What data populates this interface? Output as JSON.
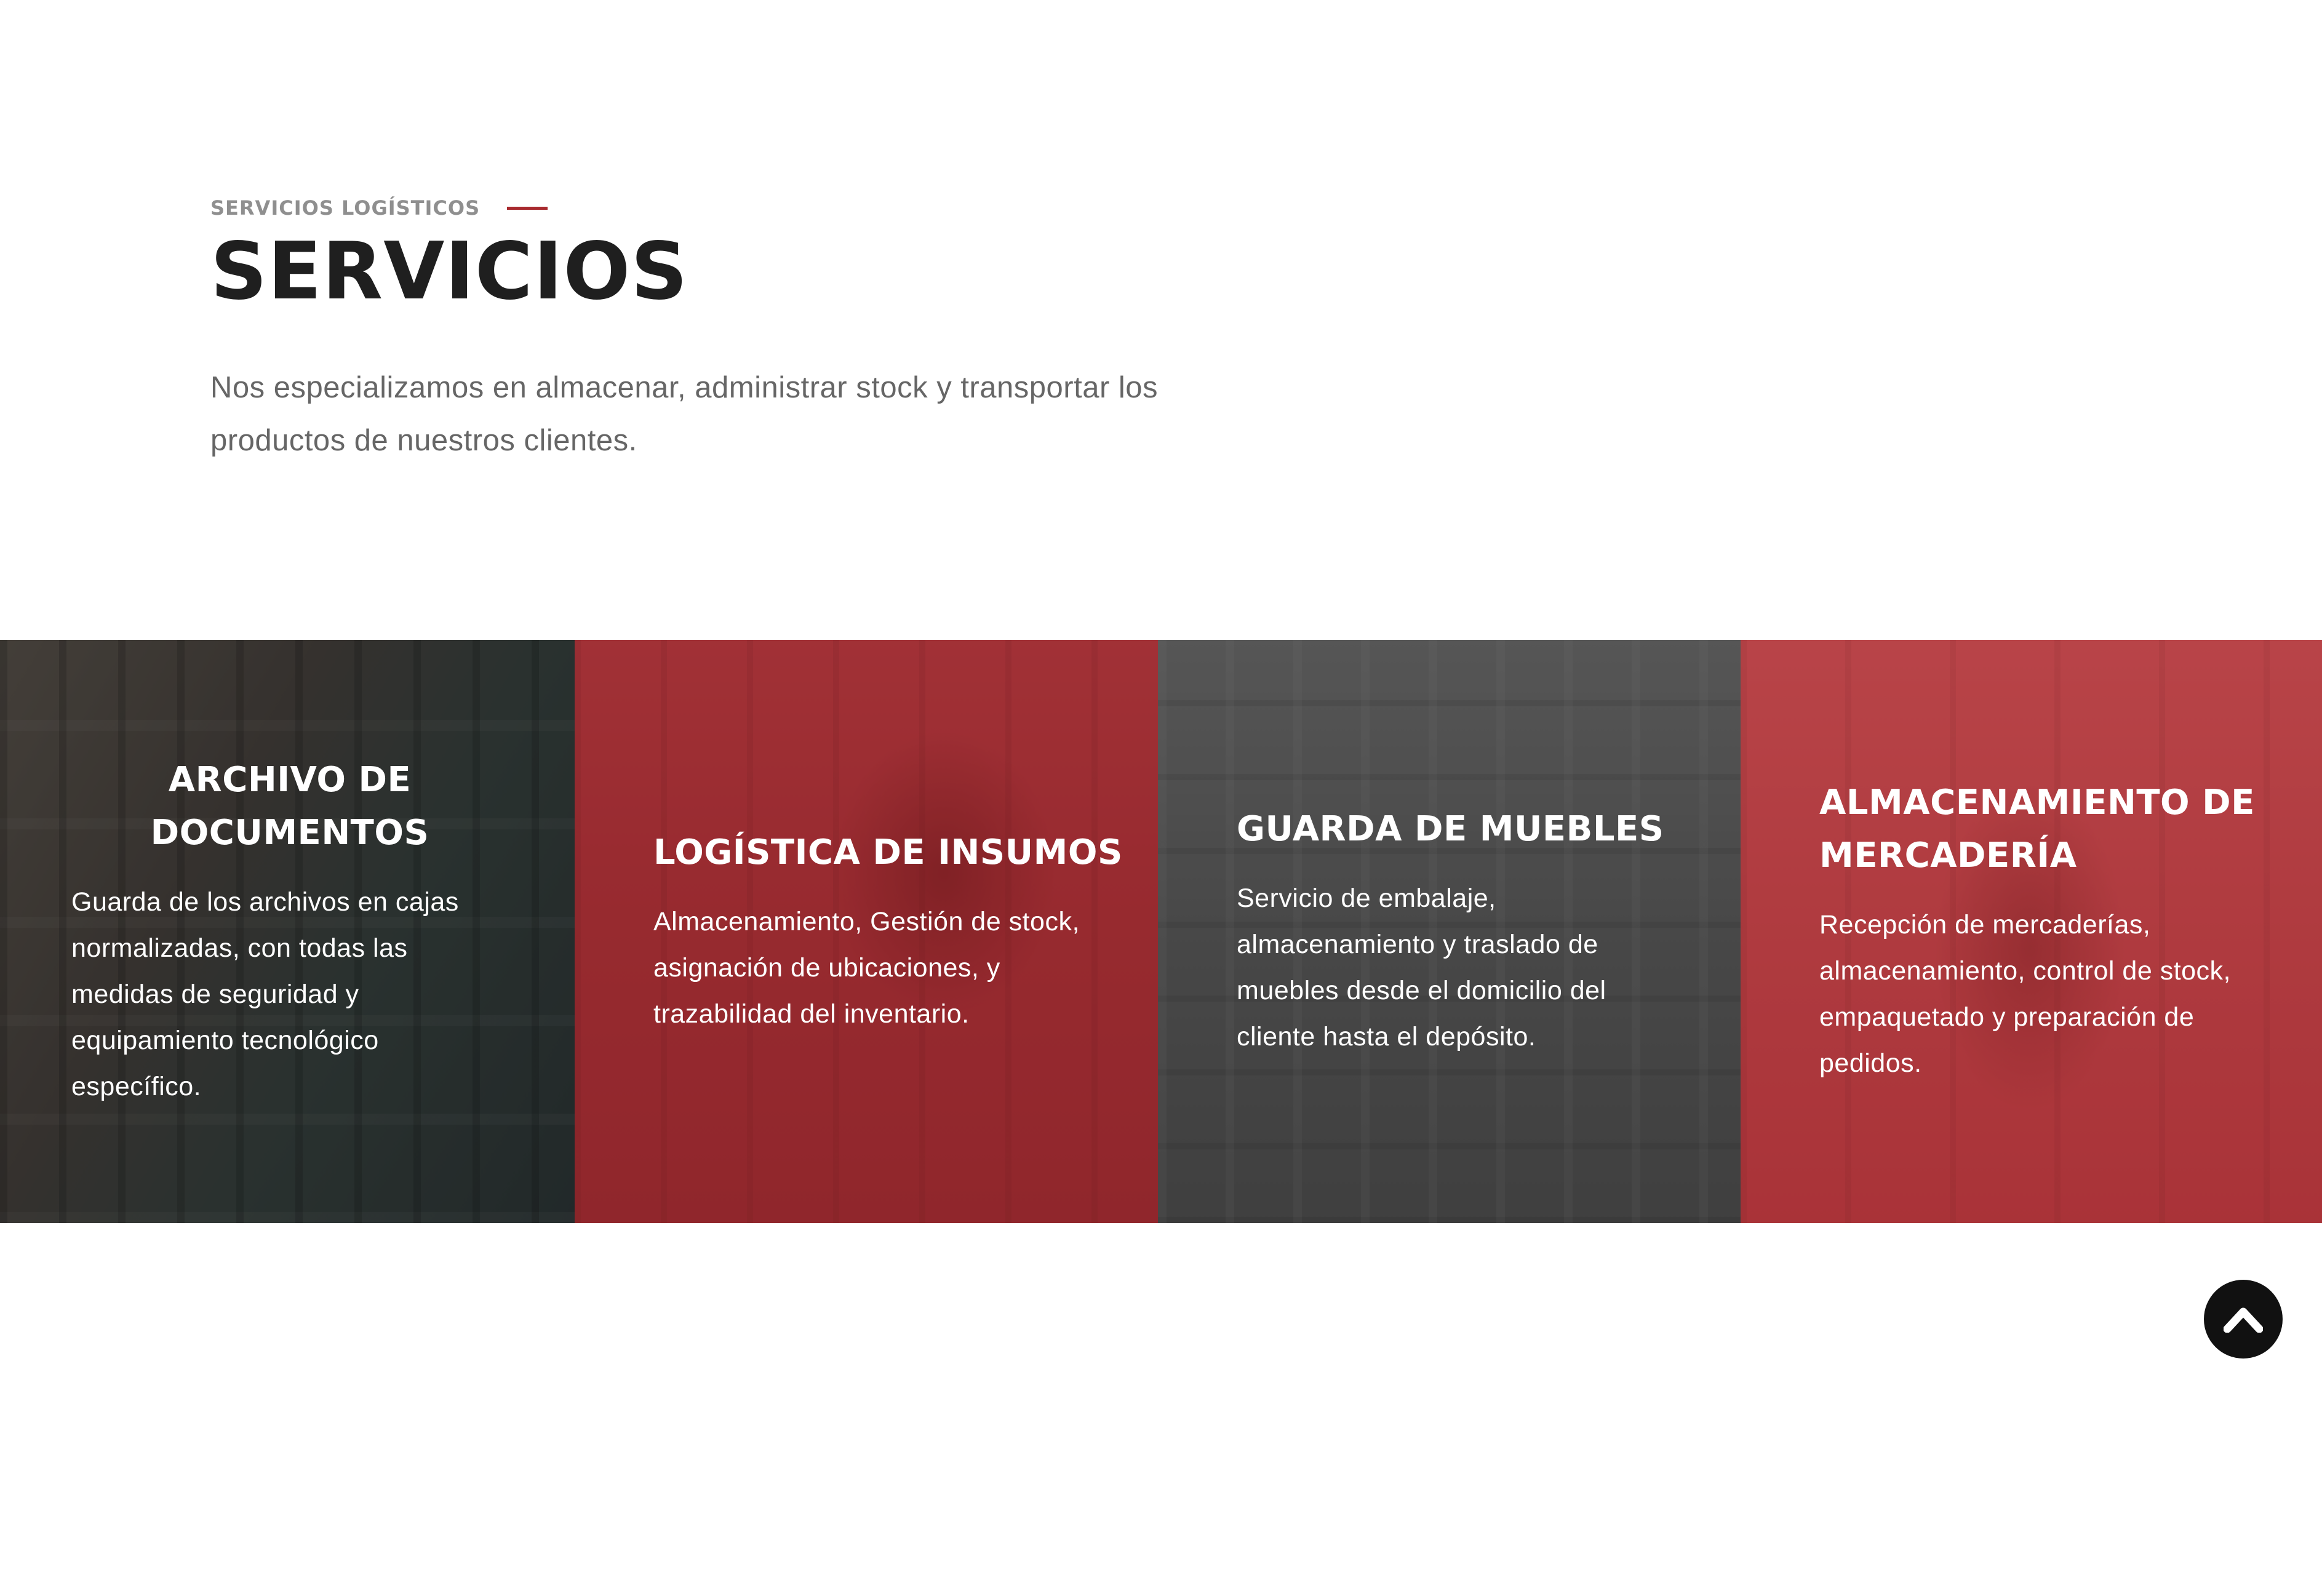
{
  "intro": {
    "eyebrow": "SERVICIOS LOGÍSTICOS",
    "title": "SERVICIOS",
    "description": "Nos especializamos en almacenar, administrar stock y transportar los productos de nuestros clientes."
  },
  "services": [
    {
      "title": "ARCHIVO DE DOCUMENTOS",
      "text": "Guarda de los archivos en cajas normalizadas, con todas las medidas de seguridad y equipamiento tecnológico específico."
    },
    {
      "title": "LOGÍSTICA DE INSUMOS",
      "text": "Almacenamiento,  Gestión de stock, asignación de ubicaciones, y trazabilidad del inventario."
    },
    {
      "title": "GUARDA DE MUEBLES",
      "text": "Servicio de embalaje, almacenamiento y traslado de muebles desde el domicilio del cliente hasta el depósito."
    },
    {
      "title": "ALMACENAMIENTO DE MERCADERÍA",
      "text": "Recepción de mercaderías, almacenamiento, control de stock, empaquetado y preparación de pedidos."
    }
  ],
  "scroll_top": {
    "icon": "chevron-up-icon"
  },
  "colors": {
    "accent": "#a82a2e",
    "title": "#1f1f1f",
    "eyebrow": "#8f8f8f",
    "body_text": "#666666",
    "card_red_overlay": "#962328",
    "card_dark_overlay": "#282828",
    "scroll_button": "#111111"
  }
}
